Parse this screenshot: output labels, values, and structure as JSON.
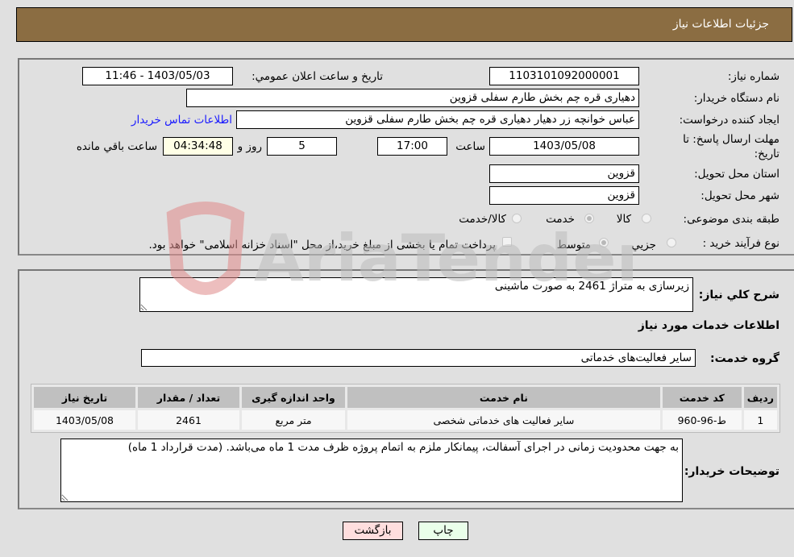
{
  "header": {
    "title": "جزئیات اطلاعات نیاز"
  },
  "form": {
    "need_number": {
      "label": "شماره نیاز:",
      "value": "1103101092000001"
    },
    "announce_datetime": {
      "label": "تاريخ و ساعت اعلان عمومي:",
      "value": "1403/05/03 - 11:46"
    },
    "buyer_org": {
      "label": "نام دستگاه خريدار:",
      "value": "دهیاری قره چم بخش طارم سفلی قزوین"
    },
    "requester": {
      "label": "ايجاد كننده درخواست:",
      "value": "عباس خوانچه زر دهیار دهیاری قره چم بخش طارم سفلی قزوین"
    },
    "buyer_contact_link": "اطلاعات تماس خريدار",
    "deadline": {
      "label": "مهلت ارسال پاسخ: تا تاریخ:",
      "date": "1403/05/08",
      "time_label": "ساعت",
      "time": "17:00",
      "days": "5",
      "days_label": "روز و",
      "remaining": "04:34:48",
      "remaining_label": "ساعت باقي مانده"
    },
    "delivery_province": {
      "label": "استان محل تحويل:",
      "value": "قزوين"
    },
    "delivery_city": {
      "label": "شهر محل تحويل:",
      "value": "قزوين"
    },
    "category": {
      "label": "طبقه بندی موضوعی:",
      "options": [
        "کالا",
        "خدمت",
        "کالا/خدمت"
      ],
      "selected": "خدمت"
    },
    "purchase_type": {
      "label": "نوع فرآیند خرید :",
      "options": [
        "جزيي",
        "متوسط"
      ],
      "selected": "متوسط",
      "treasury_note": "پرداخت تمام يا بخشی از مبلغ خريد،از محل \"اسناد خزانه اسلامی\" خواهد بود."
    }
  },
  "details": {
    "general_description_label": "شرح كلي نياز:",
    "general_description": "زیرسازی به متراژ 2461 به صورت ماشینی",
    "services_heading": "اطلاعات خدمات مورد نياز",
    "service_group_label": "گروه خدمت:",
    "service_group": "سایر فعالیت‌های خدماتی",
    "table": {
      "headers": [
        "رديف",
        "كد خدمت",
        "نام خدمت",
        "واحد اندازه گيری",
        "تعداد / مقدار",
        "تاريخ نياز"
      ],
      "rows": [
        [
          "1",
          "ط-96-960",
          "سایر فعالیت های خدماتی شخصی",
          "متر مربع",
          "2461",
          "1403/05/08"
        ]
      ]
    },
    "buyer_notes_label": "توضيحات خريدار:",
    "buyer_notes": "به جهت محدودیت زمانی در اجرای آسفالت، پیمانکار ملزم به اتمام پروژه ظرف مدت 1 ماه می‌باشد. (مدت قرارداد 1 ماه)"
  },
  "buttons": {
    "print": "چاپ",
    "back": "بازگشت"
  },
  "watermark": {
    "text": "AriaTender.neT"
  },
  "colors": {
    "header_bg": "#8b6d42",
    "print_bg": "#eaffea",
    "back_bg": "#ffdede",
    "link": "#1a1aff"
  }
}
